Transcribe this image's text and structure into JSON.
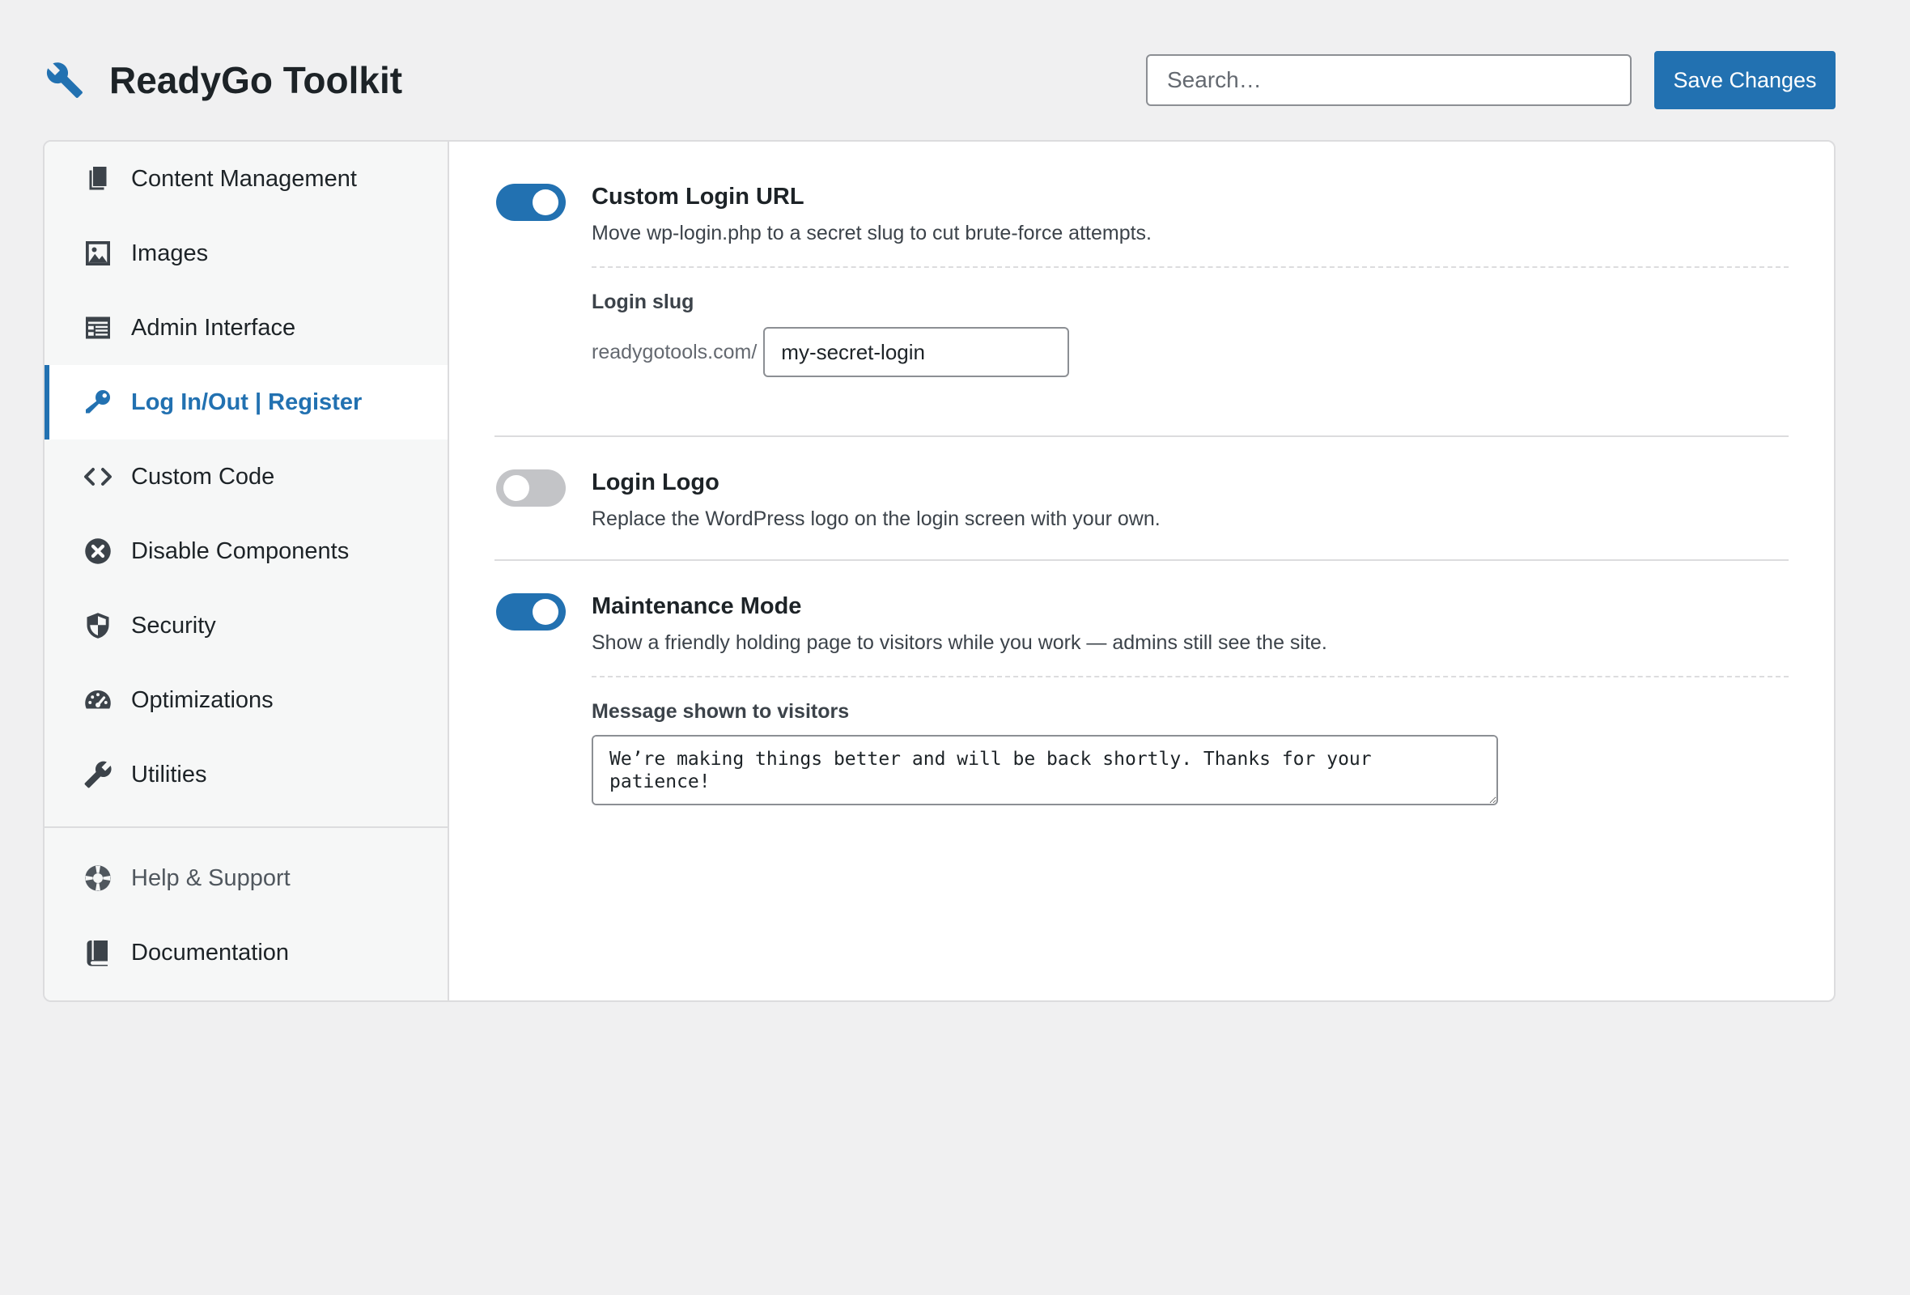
{
  "app": {
    "title": "ReadyGo Toolkit",
    "brand_icon": "wrench-icon",
    "accent_color": "#2271b1"
  },
  "search": {
    "placeholder": "Search…",
    "value": ""
  },
  "toolbar": {
    "save_label": "Save Changes"
  },
  "sidebar": {
    "items": [
      {
        "label": "Content Management",
        "icon": "pages-icon",
        "active": false
      },
      {
        "label": "Images",
        "icon": "image-icon",
        "active": false
      },
      {
        "label": "Admin Interface",
        "icon": "admin-layout-icon",
        "active": false
      },
      {
        "label": "Log In/Out | Register",
        "icon": "key-icon",
        "active": true
      },
      {
        "label": "Custom Code",
        "icon": "code-icon",
        "active": false
      },
      {
        "label": "Disable Components",
        "icon": "close-circle-icon",
        "active": false
      },
      {
        "label": "Security",
        "icon": "shield-icon",
        "active": false
      },
      {
        "label": "Optimizations",
        "icon": "dashboard-gauge-icon",
        "active": false
      },
      {
        "label": "Utilities",
        "icon": "wrench-icon",
        "active": false
      }
    ],
    "footer_items": [
      {
        "label": "Help & Support",
        "icon": "lifebuoy-icon"
      },
      {
        "label": "Documentation",
        "icon": "book-icon"
      }
    ]
  },
  "settings": [
    {
      "title": "Custom Login URL",
      "description": "Move wp-login.php to a secret slug to cut brute-force attempts.",
      "enabled": true,
      "slug_label": "Login slug",
      "slug_prefix": "readygotools.com/",
      "slug_value": "my-secret-login"
    },
    {
      "title": "Login Logo",
      "description": "Replace the WordPress logo on the login screen with your own.",
      "enabled": false
    },
    {
      "title": "Maintenance Mode",
      "description": "Show a friendly holding page to visitors while you work — admins still see the site.",
      "enabled": true,
      "message_label": "Message shown to visitors",
      "message_value": "We’re making things better and will be back shortly. Thanks for your patience!"
    }
  ]
}
